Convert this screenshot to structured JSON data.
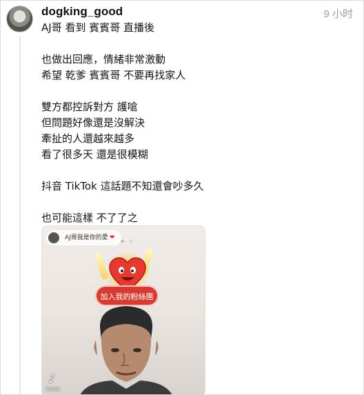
{
  "post": {
    "username": "dogking_good",
    "timestamp": "9 小时",
    "lines": [
      "AJ哥 看到 賓賓哥 直播後",
      "",
      "也做出回應，情緒非常激動",
      "希望 乾爹 賓賓哥 不要再找家人",
      "",
      "雙方都控訴對方 護嗆",
      "但問題好像還是沒解決",
      "牽扯的人還越來越多",
      "看了很多天 還是很模糊",
      "",
      "抖音 TikTok  這話題不知還會吵多久",
      "",
      "也可能這樣 不了了之"
    ]
  },
  "video": {
    "pill_text": "AJ哥我是你的愛",
    "join_button": "加入我的粉絲團",
    "watermark": "TikTok",
    "icons": {
      "tiktok": "tiktok-logo-icon",
      "heart": "heart-icon"
    }
  },
  "colors": {
    "text": "#141414",
    "timestamp": "#999999",
    "join_button": "#d73a30"
  }
}
